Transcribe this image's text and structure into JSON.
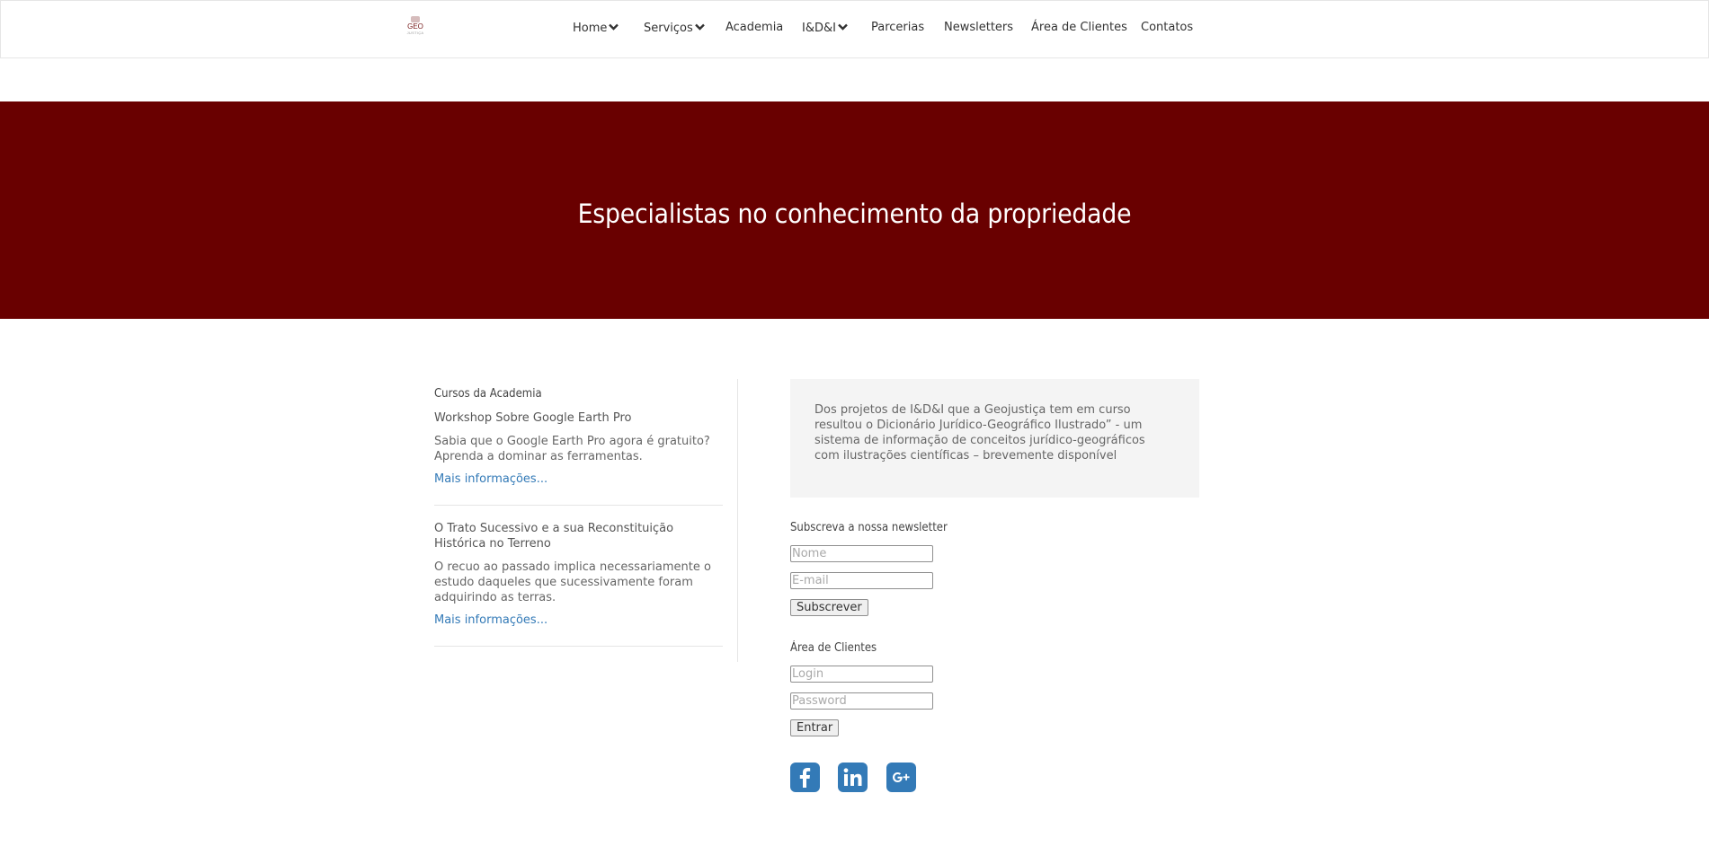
{
  "logo": {
    "line1": "GEO",
    "line2": "JUSTIÇA"
  },
  "nav": {
    "items": [
      {
        "label": "Home",
        "has_dropdown": true
      },
      {
        "label": "Serviços",
        "has_dropdown": true
      },
      {
        "label": "Academia",
        "has_dropdown": false
      },
      {
        "label": "I&D&I",
        "has_dropdown": true
      },
      {
        "label": "Parcerias",
        "has_dropdown": false
      },
      {
        "label": "Newsletters",
        "has_dropdown": false
      },
      {
        "label": "Área de Clientes",
        "has_dropdown": false
      },
      {
        "label": "Contatos",
        "has_dropdown": false
      }
    ],
    "dropdown_icon": "chevron-down-icon"
  },
  "hero": {
    "title": "Especialistas no conhecimento da propriedade",
    "background": "#690000"
  },
  "academy": {
    "heading": "Cursos da Academia",
    "courses": [
      {
        "title": "Workshop Sobre Google Earth Pro",
        "description": "Sabia que o Google Earth Pro agora é gratuito? Aprenda a dominar as ferramentas.",
        "link": "Mais informações..."
      },
      {
        "title": "O Trato Sucessivo e a sua Reconstituição Histórica no Terreno",
        "description": "O recuo ao passado implica necessariamente o estudo daqueles que sucessivamente foram adquirindo as terras.",
        "link": "Mais informações..."
      }
    ]
  },
  "info_box": {
    "text": "Dos projetos de I&D&I que a Geojustiça tem em curso resultou o Dicionário Jurídico-Geográfico Ilustrado” - um sistema de informação de conceitos jurídico-geográficos com ilustrações científicas – brevemente disponível"
  },
  "newsletter": {
    "heading": "Subscreva a nossa newsletter",
    "name_placeholder": "Nome",
    "email_placeholder": "E-mail",
    "button": "Subscrever"
  },
  "client_area": {
    "heading": "Área de Clientes",
    "login_placeholder": "Login",
    "password_placeholder": "Password",
    "button": "Entrar"
  },
  "social": {
    "icons": [
      "facebook-icon",
      "linkedin-icon",
      "google-plus-icon"
    ],
    "color": "#337ab7"
  },
  "colors": {
    "link": "#337ab7",
    "hero": "#690000",
    "info_box": "#f4f4f4"
  }
}
